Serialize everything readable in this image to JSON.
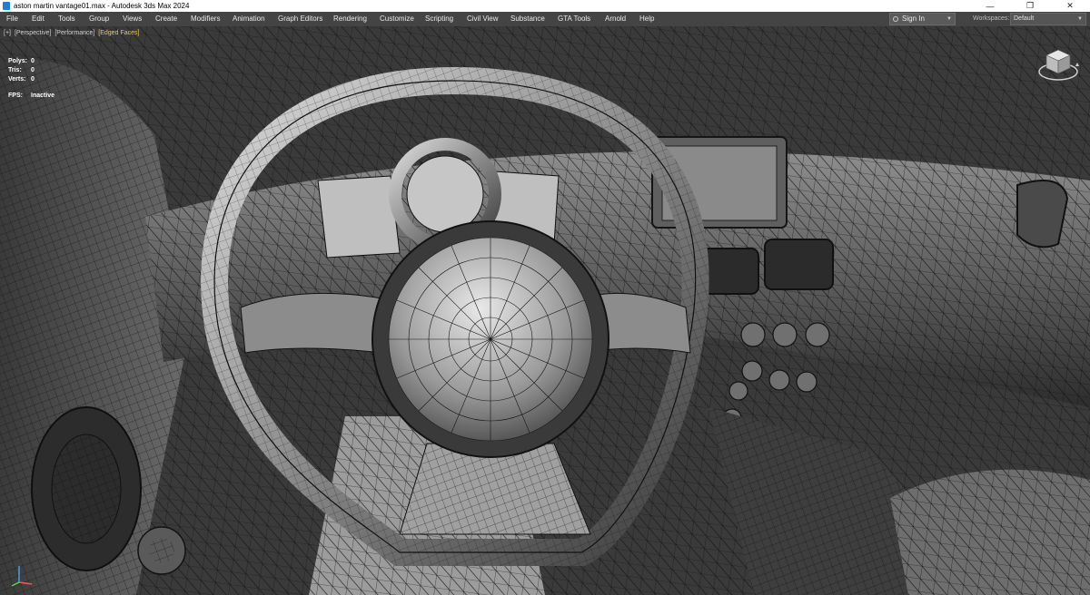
{
  "window": {
    "title": "aston martin vantage01.max - Autodesk 3ds Max 2024",
    "controls": {
      "minimize": "—",
      "restore": "❐",
      "close": "✕"
    }
  },
  "menubar": {
    "items": [
      "File",
      "Edit",
      "Tools",
      "Group",
      "Views",
      "Create",
      "Modifiers",
      "Animation",
      "Graph Editors",
      "Rendering",
      "Customize",
      "Scripting",
      "Civil View",
      "Substance",
      "GTA Tools",
      "Arnold",
      "Help"
    ],
    "sign_in": "Sign In",
    "workspaces_label": "Workspaces:",
    "workspace_value": "Default"
  },
  "viewport": {
    "labels": [
      "[+]",
      "[Perspective]",
      "[Performance]",
      "[Edged Faces]"
    ],
    "active_label_index": 3,
    "stats": [
      {
        "key": "Polys:",
        "value": "0"
      },
      {
        "key": "Tris:",
        "value": "0"
      },
      {
        "key": "Verts:",
        "value": "0"
      }
    ],
    "fps": {
      "key": "FPS:",
      "value": "Inactive"
    }
  },
  "colors": {
    "titlebar_bg": "#ffffff",
    "menubar_bg": "#444444",
    "active_label": "#f2c94c",
    "wireframe": "#101010"
  },
  "icons": [
    "app-icon",
    "user-icon",
    "viewcube-icon",
    "axis-tripod-icon"
  ]
}
